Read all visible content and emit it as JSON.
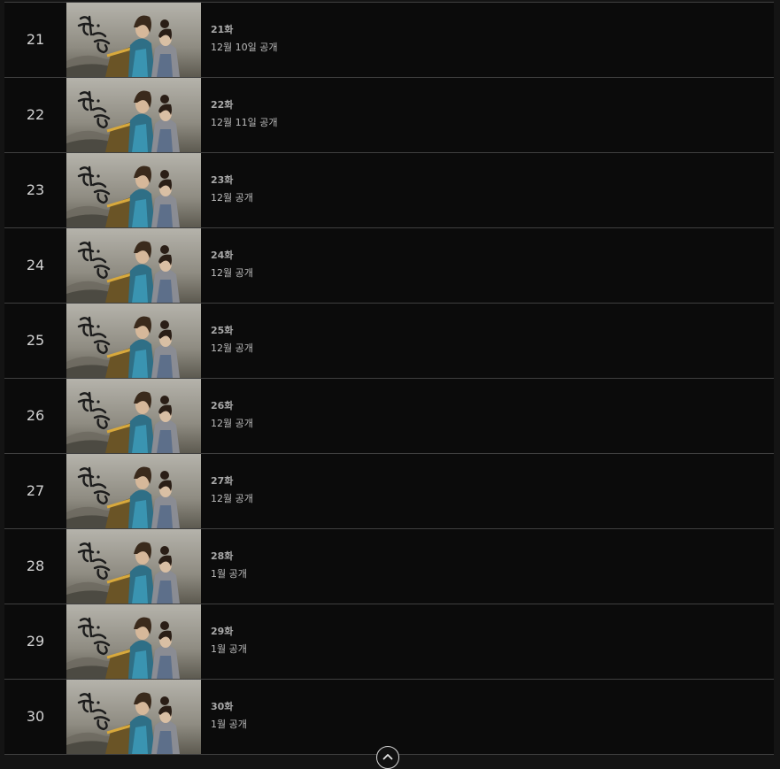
{
  "episodes": [
    {
      "num": "21",
      "title": "21화",
      "date": "12월 10일 공개"
    },
    {
      "num": "22",
      "title": "22화",
      "date": "12월 11일 공개"
    },
    {
      "num": "23",
      "title": "23화",
      "date": "12월 공개"
    },
    {
      "num": "24",
      "title": "24화",
      "date": "12월 공개"
    },
    {
      "num": "25",
      "title": "25화",
      "date": "12월 공개"
    },
    {
      "num": "26",
      "title": "26화",
      "date": "12월 공개"
    },
    {
      "num": "27",
      "title": "27화",
      "date": "12월 공개"
    },
    {
      "num": "28",
      "title": "28화",
      "date": "1월 공개"
    },
    {
      "num": "29",
      "title": "29화",
      "date": "1월 공개"
    },
    {
      "num": "30",
      "title": "30화",
      "date": "1월 공개"
    }
  ],
  "thumbnail": {
    "logo_text": "환혼",
    "logo_icon": "calligraphy-logo"
  },
  "scroll_top": {
    "icon": "chevron-up-icon"
  },
  "colors": {
    "background": "#0b0b0b",
    "divider": "#404040",
    "text_primary": "#d2d2d2",
    "text_secondary": "#a9a9a9"
  }
}
